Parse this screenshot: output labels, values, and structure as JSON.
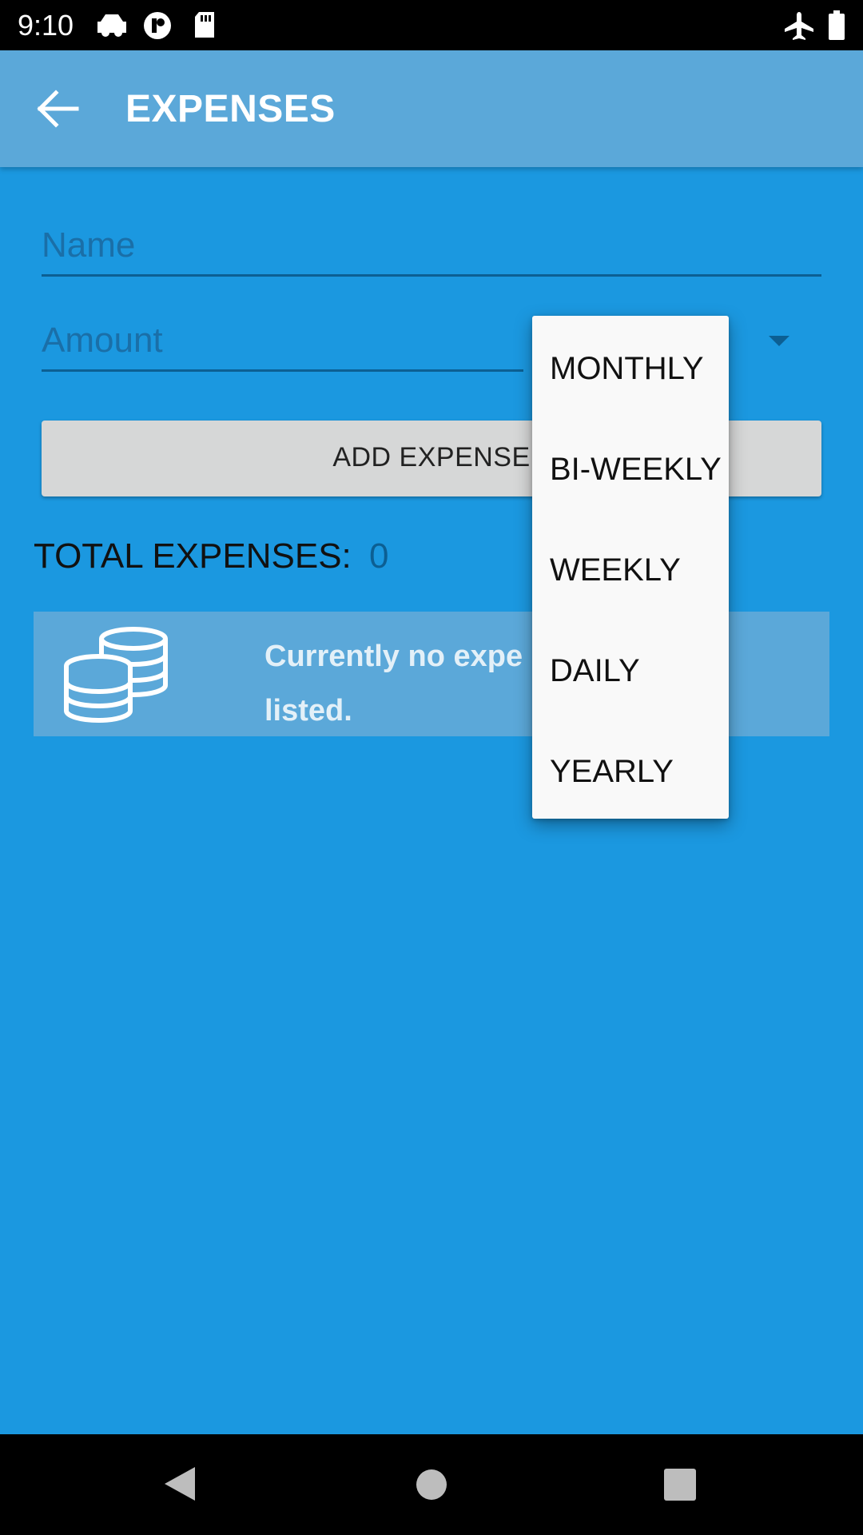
{
  "status_bar": {
    "time": "9:10",
    "icons_left": [
      "car-icon",
      "notification-icon",
      "sd-card-icon"
    ],
    "icons_right": [
      "airplane-mode-icon",
      "battery-icon"
    ]
  },
  "app_bar": {
    "title": "EXPENSES",
    "back_icon": "arrow-back-icon"
  },
  "form": {
    "name_placeholder": "Name",
    "amount_placeholder": "Amount",
    "add_button_label": "ADD EXPENSE"
  },
  "frequency_dropdown": {
    "options": [
      "MONTHLY",
      "BI-WEEKLY",
      "WEEKLY",
      "DAILY",
      "YEARLY"
    ]
  },
  "totals": {
    "label": "TOTAL EXPENSES:",
    "value": "0"
  },
  "empty_state": {
    "icon": "coins-icon",
    "message": "Currently no expe​ listed."
  },
  "nav_bar": {
    "buttons": [
      "back-triangle-icon",
      "home-circle-icon",
      "recents-square-icon"
    ]
  },
  "colors": {
    "background": "#1b98e0",
    "app_bar": "#5ba8d9",
    "dropdown": "#f9f9f9"
  }
}
